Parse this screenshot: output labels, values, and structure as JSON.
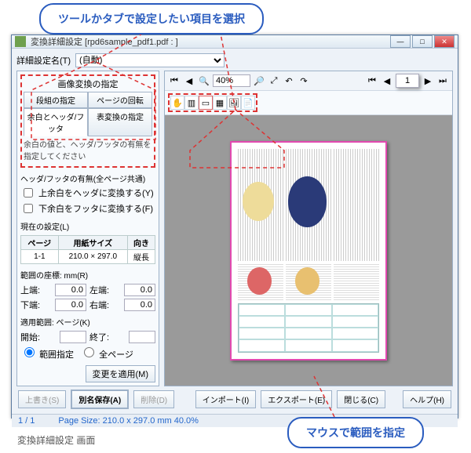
{
  "callouts": {
    "top": "ツールかタブで設定したい項目を選択",
    "bottom": "マウスで範囲を指定"
  },
  "window": {
    "title": "変換詳細設定 [rpd6sample_pdf1.pdf : ]"
  },
  "toprow": {
    "label": "詳細設定名(T)",
    "select_value": "(自動)"
  },
  "left": {
    "toolhead": "画像変換の指定",
    "tabs": {
      "a": "段組の指定",
      "b": "ページの回転",
      "c": "余白とヘッダ/フッタ",
      "d": "表変換の指定"
    },
    "note": "余白の値と、ヘッダ/フッタの有無を指定してください",
    "hf_label": "ヘッダ/フッタの有無(全ページ共通)",
    "chk_top": "上余白をヘッダに変換する(Y)",
    "chk_bottom": "下余白をフッタに変換する(F)",
    "current": "現在の設定(L)",
    "th": {
      "page": "ページ",
      "size": "用紙サイズ",
      "orient": "向き"
    },
    "row": {
      "page": "1-1",
      "size": "210.0 × 297.0",
      "orient": "縦長"
    },
    "coord_label": "範囲の座標: mm(R)",
    "top_m": "上端:",
    "left_m": "左端:",
    "bottom_m": "下端:",
    "right_m": "右端:",
    "val": "0.0",
    "apply_label": "適用範囲: ページ(K)",
    "start": "開始:",
    "end": "終了:",
    "radio_range": "範囲指定",
    "radio_all": "全ページ",
    "apply_btn": "変更を適用(M)"
  },
  "rtool": {
    "zoom": "40%",
    "page": "1"
  },
  "buttons": {
    "overwrite": "上書き(S)",
    "saveas": "別名保存(A)",
    "delete": "削除(D)",
    "import": "インポート(I)",
    "export": "エクスポート(E)",
    "close": "閉じる(C)",
    "help": "ヘルプ(H)"
  },
  "status": {
    "pages": "1 / 1",
    "size": "Page Size: 210.0 x 297.0 mm 40.0%"
  },
  "caption": "変換詳細設定 画面"
}
